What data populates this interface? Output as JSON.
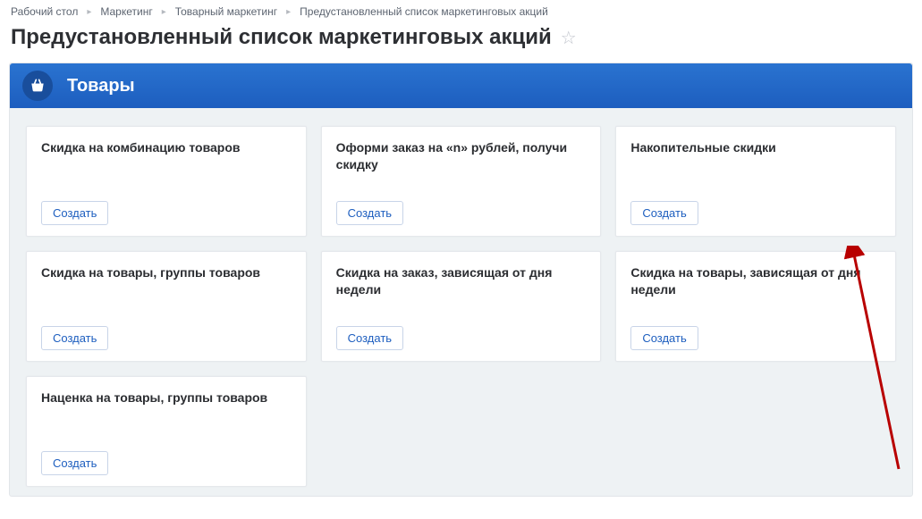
{
  "breadcrumbs": [
    {
      "label": "Рабочий стол"
    },
    {
      "label": "Маркетинг"
    },
    {
      "label": "Товарный маркетинг"
    },
    {
      "label": "Предустановленный список маркетинговых акций"
    }
  ],
  "page_title": "Предустановленный список маркетинговых акций",
  "panel": {
    "title": "Товары",
    "icon": "basket-icon"
  },
  "create_label": "Создать",
  "cards": [
    {
      "title": "Скидка на комбинацию товаров"
    },
    {
      "title": "Оформи заказ на «n» рублей, получи скидку"
    },
    {
      "title": "Накопительные скидки"
    },
    {
      "title": "Скидка на товары, группы товаров"
    },
    {
      "title": "Скидка на заказ, зависящая от дня недели"
    },
    {
      "title": "Скидка на товары, зависящая от дня недели"
    },
    {
      "title": "Наценка на товары, группы товаров"
    }
  ]
}
